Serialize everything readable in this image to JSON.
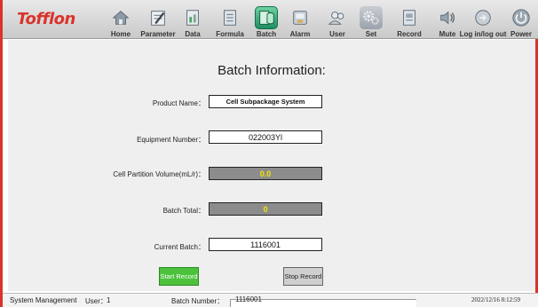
{
  "app": {
    "logo": "Tofflon"
  },
  "toolbar": {
    "items": [
      {
        "label": "Home",
        "icon": "home-icon"
      },
      {
        "label": "Parameter",
        "icon": "parameter-icon"
      },
      {
        "label": "Data",
        "icon": "data-icon"
      },
      {
        "label": "Formula",
        "icon": "formula-icon"
      },
      {
        "label": "Batch",
        "icon": "batch-icon",
        "active": true
      },
      {
        "label": "Alarm",
        "icon": "alarm-icon"
      },
      {
        "label": "User",
        "icon": "user-icon"
      },
      {
        "label": "Set",
        "icon": "gear-icon",
        "highlighted": true
      },
      {
        "label": "Record",
        "icon": "record-icon"
      },
      {
        "label": "Mute",
        "icon": "speaker-icon"
      },
      {
        "label": "Log in/log out",
        "icon": "login-icon"
      },
      {
        "label": "Power",
        "icon": "power-icon"
      }
    ]
  },
  "main": {
    "title": "Batch Information:",
    "fields": [
      {
        "label": "Product Name：",
        "value": "Cell Subpackage System"
      },
      {
        "label": "Equipment Number：",
        "value": "022003Yl"
      },
      {
        "label": "Cell Partition Volume(mL/r)：",
        "value": "0.0"
      },
      {
        "label": "Batch Total：",
        "value": "0"
      },
      {
        "label": "Current Batch：",
        "value": "1116001"
      }
    ],
    "start_button": "Start Record",
    "stop_button": "Stop Record"
  },
  "status": {
    "section": "System Management",
    "user_label": "User：",
    "user_value": "1",
    "batch_label": "Batch Number：",
    "batch_value": "1116001",
    "datetime": "2022/12/16 8:12:59"
  },
  "colors": {
    "brand": "#d9342b",
    "start_button": "#4cc23c",
    "readonly_field": "#8c8c8c",
    "readonly_text": "#f2e20a"
  }
}
